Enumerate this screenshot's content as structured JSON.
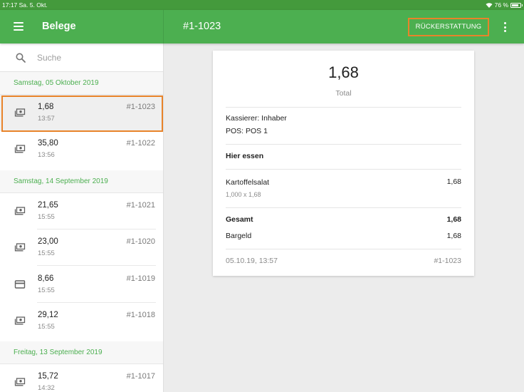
{
  "status_bar": {
    "time_date": "17:17  Sa. 5. Okt.",
    "battery_text": "76 %"
  },
  "app_bar": {
    "title": "Belege",
    "receipt_title": "#1-1023",
    "refund_label": "RÜCKERSTATTUNG"
  },
  "search": {
    "placeholder": "Suche",
    "value": ""
  },
  "groups": [
    {
      "date": "Samstag, 05 Oktober 2019"
    },
    {
      "date": "Samstag, 14 September 2019"
    },
    {
      "date": "Freitag, 13 September 2019"
    }
  ],
  "receipts": [
    {
      "amount": "1,68",
      "time": "13:57",
      "number": "#1-1023",
      "icon": "cash-icon"
    },
    {
      "amount": "35,80",
      "time": "13:56",
      "number": "#1-1022",
      "icon": "cash-icon"
    },
    {
      "amount": "21,65",
      "time": "15:55",
      "number": "#1-1021",
      "icon": "cash-icon"
    },
    {
      "amount": "23,00",
      "time": "15:55",
      "number": "#1-1020",
      "icon": "cash-icon"
    },
    {
      "amount": "8,66",
      "time": "15:55",
      "number": "#1-1019",
      "icon": "card-icon"
    },
    {
      "amount": "29,12",
      "time": "15:55",
      "number": "#1-1018",
      "icon": "cash-icon"
    },
    {
      "amount": "15,72",
      "time": "14:32",
      "number": "#1-1017",
      "icon": "cash-icon"
    }
  ],
  "receipt_detail": {
    "total": "1,68",
    "total_label": "Total",
    "cashier": "Kassierer: Inhaber",
    "pos": "POS: POS 1",
    "dining_option": "Hier essen",
    "item": {
      "name": "Kartoffelsalat",
      "qty_line": "1,000 x 1,68",
      "price": "1,68"
    },
    "gesamt_label": "Gesamt",
    "gesamt_value": "1,68",
    "payment_label": "Bargeld",
    "payment_value": "1,68",
    "datetime": "05.10.19, 13:57",
    "number": "#1-1023"
  },
  "colors": {
    "primary": "#4caf50",
    "status_bar": "#449a3c",
    "highlight": "#e8832a"
  }
}
